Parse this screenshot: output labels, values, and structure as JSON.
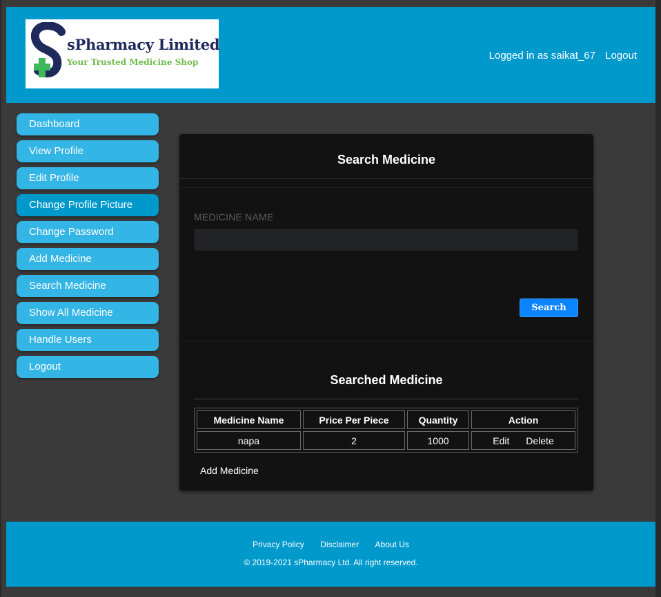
{
  "header": {
    "brand_name": "sPharmacy Limited",
    "brand_tagline": "Your Trusted Medicine Shop",
    "logged_in_text": "Logged in as saikat_67",
    "logout_label": "Logout"
  },
  "sidebar": {
    "items": [
      {
        "label": "Dashboard"
      },
      {
        "label": "View Profile"
      },
      {
        "label": "Edit Profile"
      },
      {
        "label": "Change Profile Picture"
      },
      {
        "label": "Change Password"
      },
      {
        "label": "Add Medicine"
      },
      {
        "label": "Search Medicine"
      },
      {
        "label": "Show All Medicine"
      },
      {
        "label": "Handle Users"
      },
      {
        "label": "Logout"
      }
    ]
  },
  "search_panel": {
    "title": "Search Medicine",
    "field_label": "MEDICINE NAME",
    "input_value": "",
    "search_button": "Search"
  },
  "results": {
    "title": "Searched Medicine",
    "columns": [
      "Medicine Name",
      "Price Per Piece",
      "Quantity",
      "Action"
    ],
    "rows": [
      {
        "name": "napa",
        "price": "2",
        "quantity": "1000",
        "edit": "Edit",
        "delete": "Delete"
      }
    ],
    "add_link": "Add Medicine"
  },
  "footer": {
    "links": [
      "Privacy Policy",
      "Disclaimer",
      "About Us"
    ],
    "copyright": "© 2019-2021 sPharmacy Ltd. All right reserved."
  },
  "colors": {
    "header_bg": "#0099cc",
    "sidebar_item": "#33b5e5",
    "sidebar_active": "#0099cc",
    "panel_bg": "#121212",
    "page_bg": "#3a3a3a",
    "button_blue": "#0d84ff",
    "logo_navy": "#1f2a5c",
    "logo_green": "#6dbd4a"
  }
}
